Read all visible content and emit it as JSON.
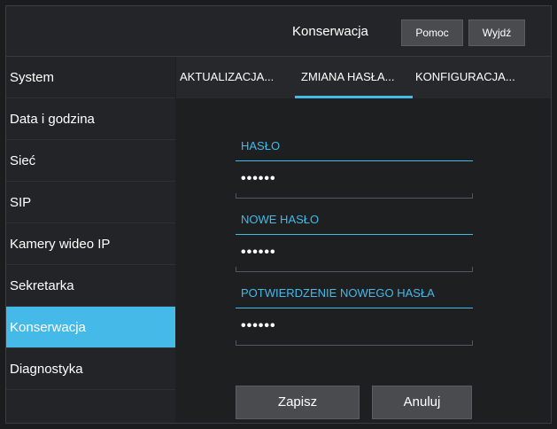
{
  "header": {
    "title": "Konserwacja",
    "help_label": "Pomoc",
    "exit_label": "Wyjdź"
  },
  "sidebar": {
    "items": [
      {
        "label": "System"
      },
      {
        "label": "Data i godzina"
      },
      {
        "label": "Sieć"
      },
      {
        "label": "SIP"
      },
      {
        "label": "Kamery wideo IP"
      },
      {
        "label": "Sekretarka"
      },
      {
        "label": "Konserwacja",
        "active": true
      },
      {
        "label": "Diagnostyka"
      }
    ]
  },
  "tabs": [
    {
      "label": "AKTUALIZACJA..."
    },
    {
      "label": "ZMIANA HASŁA...",
      "active": true
    },
    {
      "label": "KONFIGURACJA..."
    }
  ],
  "form": {
    "password_label": "HASŁO",
    "password_value": "••••••",
    "new_password_label": "NOWE HASŁO",
    "new_password_value": "••••••",
    "confirm_label": "POTWIERDZENIE NOWEGO HASŁA",
    "confirm_value": "••••••"
  },
  "actions": {
    "save_label": "Zapisz",
    "cancel_label": "Anuluj"
  },
  "colors": {
    "accent": "#45b9e8",
    "background": "#1e1f21",
    "button": "#4a4b4e"
  }
}
